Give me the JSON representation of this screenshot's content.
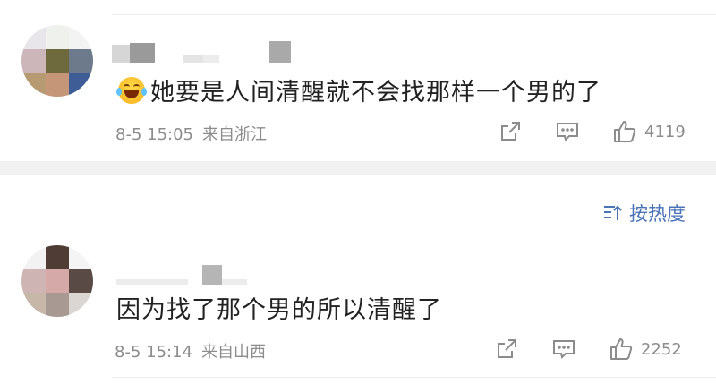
{
  "comments": [
    {
      "text": "她要是人间清醒就不会找那样一个男的了",
      "has_emoji": true,
      "emoji": "laughing-tears",
      "date": "8-5 15:05",
      "location": "来自浙江",
      "likes": "4119"
    },
    {
      "text": "因为找了那个男的所以清醒了",
      "has_emoji": false,
      "date": "8-5 15:14",
      "location": "来自山西",
      "likes": "2252"
    }
  ],
  "sort": {
    "label": "按热度"
  },
  "icons": {
    "share": "share-icon",
    "reply": "comment-icon",
    "like": "thumbs-up-icon",
    "sort": "sort-icon"
  },
  "colors": {
    "accent": "#4a73b8",
    "meta": "#8c8c8c",
    "divider": "#f1f1f1"
  }
}
